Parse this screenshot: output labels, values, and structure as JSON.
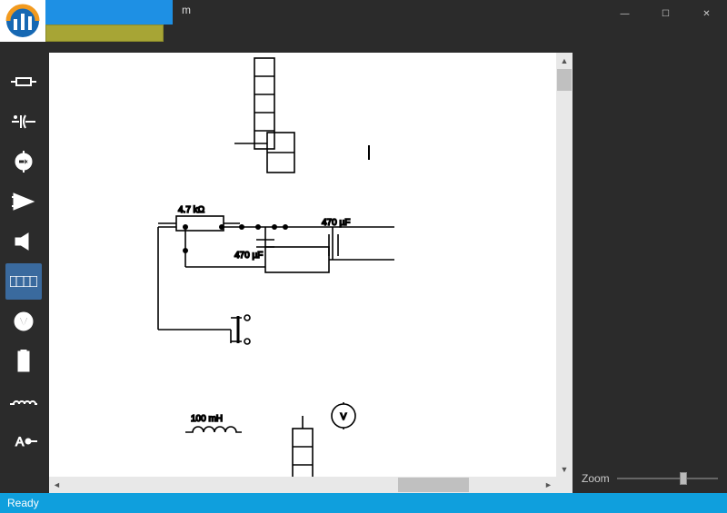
{
  "window": {
    "title_suffix": "m",
    "controls": {
      "min": "—",
      "max": "☐",
      "close": "✕"
    }
  },
  "toolbox": {
    "items": [
      {
        "name": "tool-resistor",
        "selected": false
      },
      {
        "name": "tool-capacitor-polar",
        "selected": false
      },
      {
        "name": "tool-source",
        "selected": false
      },
      {
        "name": "tool-opamp",
        "selected": false
      },
      {
        "name": "tool-speaker",
        "selected": false
      },
      {
        "name": "tool-array",
        "selected": true
      },
      {
        "name": "tool-voltmeter",
        "selected": false
      },
      {
        "name": "tool-battery",
        "selected": false
      },
      {
        "name": "tool-inductor",
        "selected": false
      },
      {
        "name": "tool-ammeter",
        "selected": false
      }
    ]
  },
  "components": {
    "r1_label": "4.7 kΩ",
    "c1_label": "470 µF",
    "c2_label": "470 µF",
    "l1_label": "100 mH",
    "meter_v": "V"
  },
  "hscroll": {
    "thumb_left_pct": 70,
    "thumb_width_pct": 15
  },
  "rightpanel": {
    "zoom_label": "Zoom",
    "zoom_pos_pct": 62
  },
  "status": {
    "text": "Ready"
  }
}
